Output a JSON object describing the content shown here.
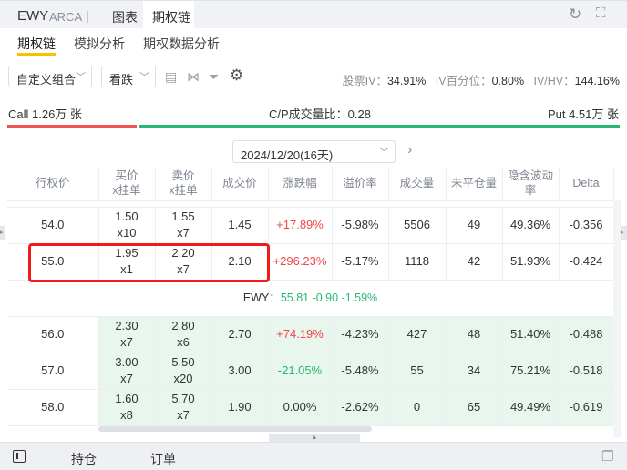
{
  "header": {
    "symbol": "EWY",
    "exchange": "ARCA",
    "tabs": [
      "图表",
      "期权链"
    ],
    "active_tab": "期权链"
  },
  "subtabs": [
    "期权链",
    "模拟分析",
    "期权数据分析"
  ],
  "toolbar": {
    "combo": "自定义组合",
    "direction": "看跌",
    "stock_iv_label": "股票IV：",
    "stock_iv": "34.91%",
    "iv_pct_label": "IV百分位：",
    "iv_pct": "0.80%",
    "ivhv_label": "IV/HV：",
    "ivhv": "144.16%"
  },
  "volume": {
    "call": "Call 1.26万 张",
    "cp_label": "C/P成交量比：",
    "cp": "0.28",
    "put": "Put 4.51万 张",
    "call_fraction": 0.22
  },
  "expiry": "2024/12/20(16天)",
  "columns": [
    "行权价",
    "买价\nx挂单",
    "卖价\nx挂单",
    "成交价",
    "涨跌幅",
    "溢价率",
    "成交量",
    "未平仓量",
    "隐含波动率",
    "Delta"
  ],
  "col_labels": {
    "bid1": "买价",
    "bid2": "x挂单",
    "ask1": "卖价",
    "ask2": "x挂单"
  },
  "rows_above": [
    {
      "strike": "54.0",
      "bid": "1.50",
      "bidsz": "x10",
      "ask": "1.55",
      "asksz": "x7",
      "last": "1.45",
      "chg": "+17.89%",
      "prem": "-5.98%",
      "vol": "5506",
      "oi": "49",
      "iv": "49.36%",
      "delta": "-0.356"
    },
    {
      "strike": "55.0",
      "bid": "1.95",
      "bidsz": "x1",
      "ask": "2.20",
      "asksz": "x7",
      "last": "2.10",
      "chg": "+296.23%",
      "prem": "-5.17%",
      "vol": "1118",
      "oi": "42",
      "iv": "51.93%",
      "delta": "-0.424"
    }
  ],
  "underlying": {
    "label": "EWY：",
    "price": "55.81",
    "change": "-0.90",
    "pct": "-1.59%"
  },
  "rows_below": [
    {
      "strike": "56.0",
      "bid": "2.30",
      "bidsz": "x7",
      "ask": "2.80",
      "asksz": "x6",
      "last": "2.70",
      "chg": "+74.19%",
      "prem": "-4.23%",
      "vol": "427",
      "oi": "48",
      "iv": "51.40%",
      "delta": "-0.488"
    },
    {
      "strike": "57.0",
      "bid": "3.00",
      "bidsz": "x7",
      "ask": "5.50",
      "asksz": "x20",
      "last": "3.00",
      "chg": "-21.05%",
      "prem": "-5.48%",
      "vol": "55",
      "oi": "34",
      "iv": "75.21%",
      "delta": "-0.518"
    },
    {
      "strike": "58.0",
      "bid": "1.60",
      "bidsz": "x8",
      "ask": "5.70",
      "asksz": "x7",
      "last": "1.90",
      "chg": "0.00%",
      "prem": "-2.62%",
      "vol": "0",
      "oi": "65",
      "iv": "49.49%",
      "delta": "-0.619"
    }
  ],
  "bottom": {
    "positions": "持仓",
    "orders": "订单"
  }
}
